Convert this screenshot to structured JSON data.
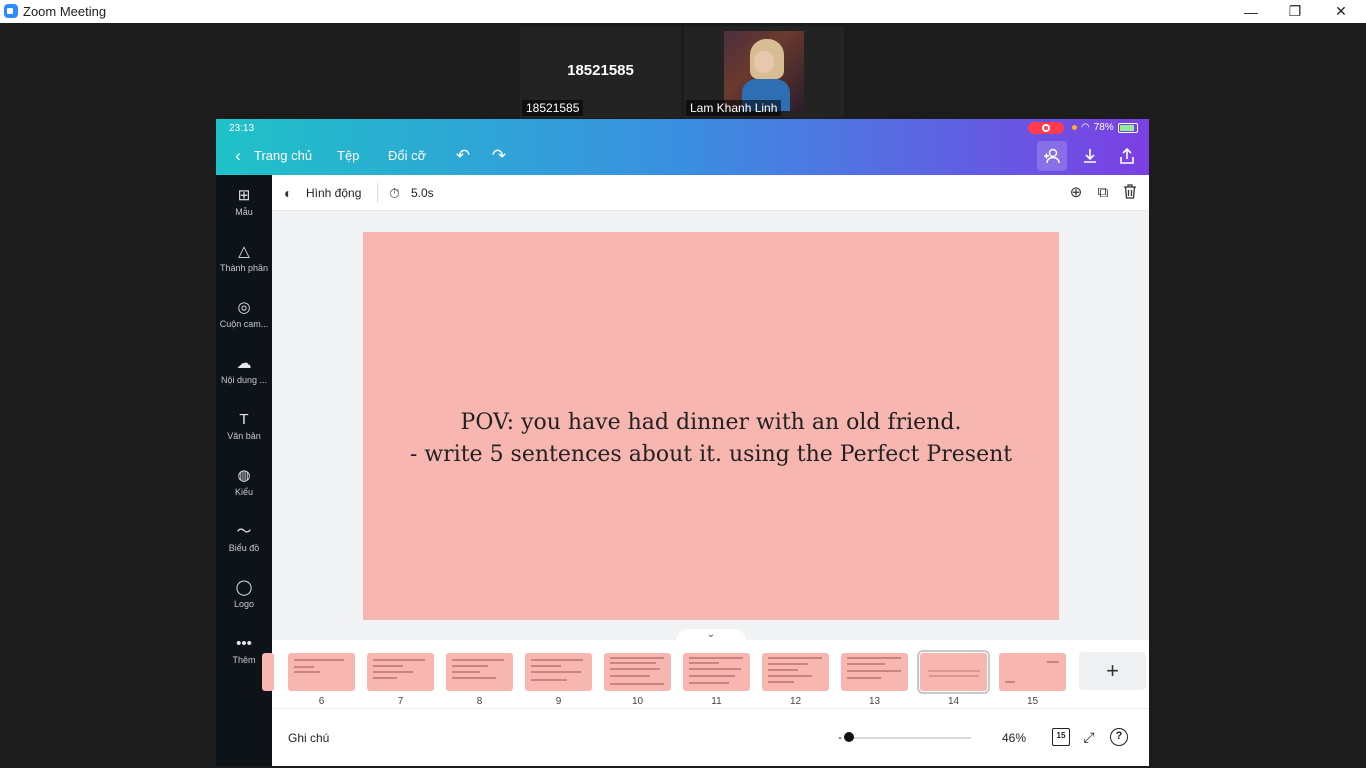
{
  "window": {
    "title": "Zoom Meeting",
    "icon": "zoom-camera-icon",
    "minimize": "—",
    "restore": "❐",
    "close": "✕"
  },
  "participants": [
    {
      "display": "18521585",
      "label": "18521585"
    },
    {
      "label": "Lam Khanh Linh"
    }
  ],
  "device_status": {
    "time": "23:13",
    "battery": "78%"
  },
  "canva": {
    "topbar": {
      "back_icon": "‹",
      "home": "Trang chủ",
      "file": "Tệp",
      "resize": "Đổi cỡ",
      "undo_icon": "↶",
      "redo_icon": "↷",
      "collab_icon": "people-plus-icon",
      "download_icon": "download-icon",
      "share_icon": "share-icon"
    },
    "sidebar": [
      {
        "label": "Mẫu",
        "icon": "⊞"
      },
      {
        "label": "Thành phần",
        "icon": "△"
      },
      {
        "label": "Cuộn cam...",
        "icon": "◎"
      },
      {
        "label": "Nội dung ...",
        "icon": "☁"
      },
      {
        "label": "Văn bản",
        "icon": "T"
      },
      {
        "label": "Kiểu",
        "icon": "◍"
      },
      {
        "label": "Biểu đồ",
        "icon": "〜"
      },
      {
        "label": "Logo",
        "icon": "◯"
      },
      {
        "label": "Thêm",
        "icon": "•••"
      }
    ],
    "toolbar": {
      "animate": "Hình động",
      "animate_icon": "◐",
      "timer_icon": "⏱",
      "duration": "5.0s",
      "add_page_icon": "⊕",
      "duplicate_icon": "⧉",
      "delete_icon": "🗑"
    },
    "slide": {
      "line1": "POV: you have had dinner with an old friend.",
      "line2": "- write 5 sentences about it. using the Perfect Present",
      "background": "#f8b6b0"
    },
    "pages": [
      "6",
      "7",
      "8",
      "9",
      "10",
      "11",
      "12",
      "13",
      "14",
      "15"
    ],
    "selected_page": "14",
    "collapse_icon": "⌄",
    "add_page_label": "+",
    "bottom": {
      "notes": "Ghi chú",
      "zoom_minus": "-",
      "zoom": "46%",
      "page_count": "15",
      "fullscreen_icon": "⤢",
      "help_icon": "?"
    }
  }
}
